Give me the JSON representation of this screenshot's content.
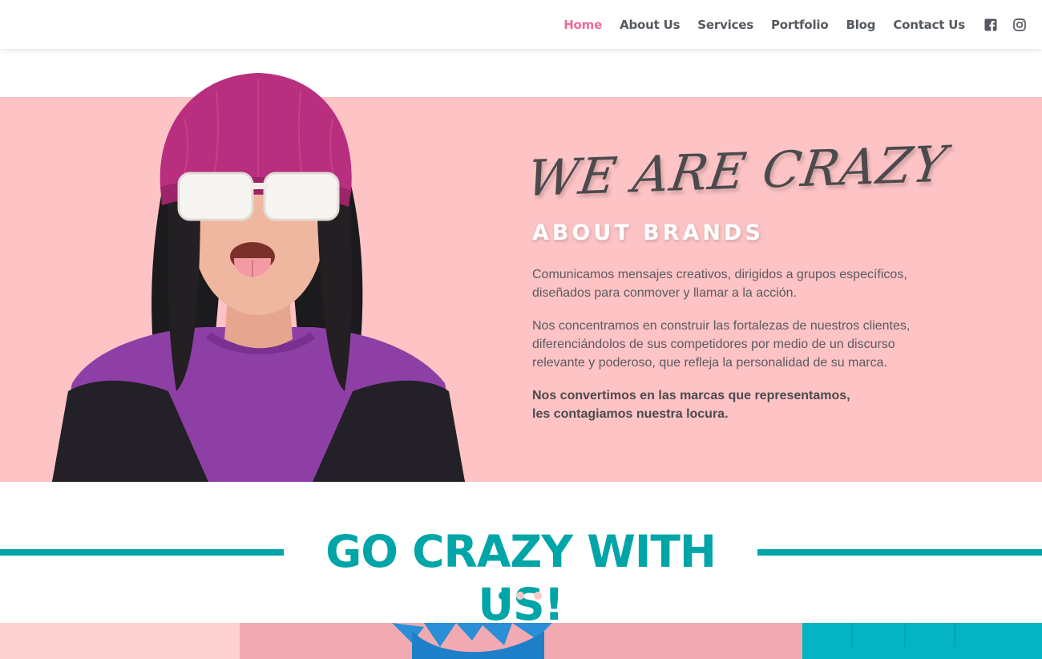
{
  "nav": {
    "items": [
      {
        "label": "Home",
        "active": true
      },
      {
        "label": "About Us"
      },
      {
        "label": "Services"
      },
      {
        "label": "Portfolio"
      },
      {
        "label": "Blog"
      },
      {
        "label": "Contact Us"
      }
    ],
    "social": [
      "facebook-icon",
      "instagram-icon"
    ]
  },
  "hero": {
    "script_title": "WE ARE CRAZY",
    "subtitle": "ABOUT BRANDS",
    "paragraphs": [
      "Comunicamos mensajes creativos, dirigidos a grupos específicos, diseñados para conmover y llamar a la acción.",
      "Nos concentramos en construir las fortalezas de nuestros clientes, diferenciándolos de sus competidores por medio de un discurso relevante y poderoso, que refleja la personalidad de su marca."
    ],
    "bold_lines": [
      "Nos convertimos en las marcas que representamos,",
      "les contagiamos nuestra locura."
    ]
  },
  "section": {
    "title": "GO CRAZY WITH US!",
    "slider_dots": 3,
    "active_dot": 0
  },
  "colors": {
    "accent": "#00a5a8",
    "pink_band": "#fdc3c5",
    "nav_active": "#f06b96"
  }
}
